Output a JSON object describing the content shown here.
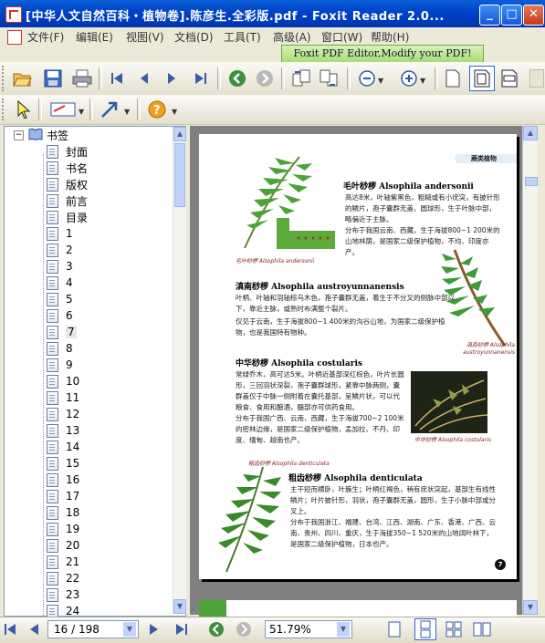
{
  "window": {
    "title": "[中华人文自然百科・植物卷].陈彦生.全彩版.pdf - Foxit Reader 2.0...",
    "min_symbol": "_",
    "max_symbol": "□",
    "close_symbol": "✕"
  },
  "menu": {
    "items": [
      "文件(F)",
      "编辑(E)",
      "视图(V)",
      "文档(D)",
      "工具(T)",
      "高级(A)",
      "窗口(W)",
      "帮助(H)"
    ]
  },
  "promo": {
    "label": "Foxit PDF Editor,Modify your PDF!"
  },
  "bookmarks": {
    "root": "书签",
    "expander": "−",
    "items": [
      "封面",
      "书名",
      "版权",
      "前言",
      "目录",
      "1",
      "2",
      "3",
      "4",
      "5",
      "6",
      "7",
      "8",
      "9",
      "10",
      "11",
      "12",
      "13",
      "14",
      "15",
      "16",
      "17",
      "18",
      "19",
      "20",
      "21",
      "22",
      "23",
      "24"
    ],
    "selected_index": 11
  },
  "page": {
    "header_tag": "蕨类植物",
    "page_number": "7",
    "s1": {
      "title": "毛叶桫椤 Alsophila andersonii",
      "body": "高达8米，叶轴紫黑色，粗糙或有小疣突，有披针形的鳞片，孢子囊群无盖，圆球形，生于叶脉中部，略偏近于主脉。",
      "body2": "分布于我国云南、西藏，生于海拔800~1 200米的山地林荫，是国家二级保护植物，不均、印度亦产。",
      "caption": "毛叶桫椤 Alsophila andersonii"
    },
    "s2": {
      "title": "滇南桫椤 Alsophila austroyunnanensis",
      "body": "叶柄、叶轴和羽轴棕乌木色，孢子囊群无盖，着生于不分叉的侧脉中部以下，靠近主脉，或熟时布满整个裂片。",
      "body2": "仅见于云南，生于海拔800~1 400米的沟谷山地，为国家二级保护植物，也是我国特有物种。",
      "caption": "滇南桫椤 Alsophila austroyunnanensis"
    },
    "s3": {
      "title": "中华桫椤 Alsophila costularis",
      "body": "常绿乔木，高可达5米。叶柄近基部深红棕色，叶片长圆形，三回羽状深裂，孢子囊群球形，紧靠中脉两侧，囊群盖仅于中脉一侧附着在囊托基部，呈鳞片状，可以代粮食、食用和酿酒，髓部亦可供药食用。",
      "body2": "分布于我国广西、云南、西藏，生于海拔700~2 100米的密林边缘，是国家二级保护植物，孟加拉、不丹、印度、缅甸、越南也产。",
      "caption": "中华桫椤 Alsophila costularis"
    },
    "s4": {
      "title": "粗齿桫椤 Alsophila denticulata",
      "body": "主干短而横卧，叶簇生；叶柄红褐色，稍有疣状突起，基部生有线性鳞片；叶片披针形，羽状，孢子囊群无盖，圆形，生于小脉中部或分叉上。",
      "body2": "分布于我国浙江、福建、台湾、江西、湖南、广东、香港、广西、云南、贵州、四川、重庆，生于海拔350~1 520米的山地阔叶林下，是国家二级保护植物，日本也产。",
      "caption": "粗齿桫椤 Alsophila denticulata"
    }
  },
  "status": {
    "page_display": "16 / 198",
    "zoom": "51.79%"
  },
  "colors": {
    "titlebar": "#0A5FD8",
    "toolbar": "#ECE9D8",
    "page_bg": "#808080",
    "fern": "#3E8E2E"
  },
  "icons": [
    "open-folder-icon",
    "save-icon",
    "print-icon",
    "first-page-icon",
    "prev-page-icon",
    "next-page-icon",
    "last-page-icon",
    "back-icon",
    "forward-icon",
    "rotate-left-icon",
    "rotate-right-icon",
    "zoom-out-icon",
    "zoom-in-icon",
    "single-page-icon",
    "fit-page-icon",
    "fit-width-icon",
    "select-cursor-icon",
    "annotation-icon",
    "arrow-tool-icon",
    "help-icon"
  ]
}
